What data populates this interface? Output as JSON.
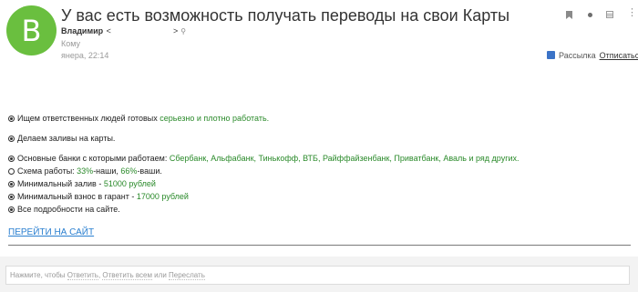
{
  "colors": {
    "avatar": "#6abf3f",
    "green_text": "#2a8a2a",
    "link": "#2a7fd0"
  },
  "header": {
    "avatar_letter": "B",
    "subject": "У вас есть возможность получать переводы на свои Карты",
    "sender_name": "Владимир",
    "sender_addr_left": "<",
    "sender_addr_right": ">",
    "to_label": "Кому",
    "date": "янера, 22:14",
    "icons": [
      "bookmark-icon",
      "dot-icon",
      "grid-icon",
      "more-icon"
    ],
    "mailing_label": "Рассылка",
    "unsubscribe_label": "Отписаться"
  },
  "body": {
    "l1_pre": "Ищем ответственных людей готовых ",
    "l1_green": "серьезно и плотно работать.",
    "l2": "Делаем заливы на карты.",
    "l3_pre": "Основные банки с которыми работаем: ",
    "l3_green": "Сбербанк, Альфабанк, Тинькофф, ВТБ, Райффайзенбанк, Приватбанк, Аваль и ряд других.",
    "l4_pre": "Схема работы: ",
    "l4_g1": "33%",
    "l4_mid": "-наши, ",
    "l4_g2": "66%",
    "l4_post": "-ваши.",
    "l5_pre": "Минимальный залив - ",
    "l5_green": "51000 рублей",
    "l6_pre": "Минимальный взнос в гарант - ",
    "l6_green": "17000 рублей",
    "l7": "Все подробности на сайте.",
    "cta": "ПЕРЕЙТИ НА САЙТ"
  },
  "reply": {
    "prefix": "Нажмите, чтобы ",
    "reply_label": "Ответить",
    "sep1": ", ",
    "reply_all_label": "Ответить всем",
    "sep2": " или ",
    "forward_label": "Переслать"
  }
}
